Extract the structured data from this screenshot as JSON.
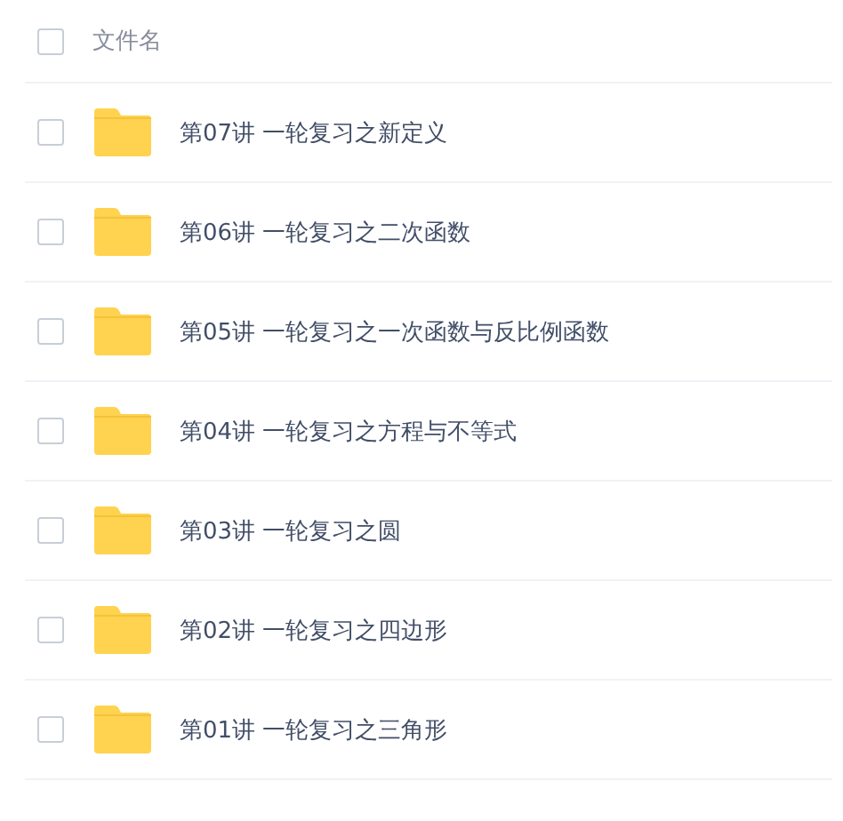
{
  "header": {
    "label": "文件名",
    "checked": false
  },
  "files": [
    {
      "name": "第07讲 一轮复习之新定义",
      "checked": false
    },
    {
      "name": "第06讲 一轮复习之二次函数",
      "checked": false
    },
    {
      "name": "第05讲 一轮复习之一次函数与反比例函数",
      "checked": false
    },
    {
      "name": "第04讲 一轮复习之方程与不等式",
      "checked": false
    },
    {
      "name": "第03讲 一轮复习之圆",
      "checked": false
    },
    {
      "name": "第02讲 一轮复习之四边形",
      "checked": false
    },
    {
      "name": "第01讲 一轮复习之三角形",
      "checked": false
    }
  ]
}
